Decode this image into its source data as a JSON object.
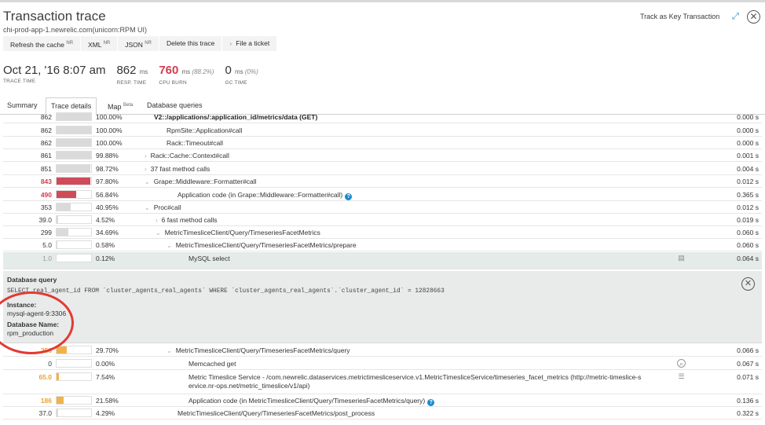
{
  "header": {
    "title": "Transaction trace",
    "subtitle": "chi-prod-app-1.newrelic.com(unicorn:RPM UI)",
    "key_link": "Track as Key Transaction"
  },
  "toolbar": [
    {
      "label": "Refresh the cache",
      "sup": "NR"
    },
    {
      "label": "XML",
      "sup": "NR"
    },
    {
      "label": "JSON",
      "sup": "NR"
    },
    {
      "label": "Delete this trace",
      "sup": ""
    },
    {
      "label": "File a ticket",
      "sup": ""
    }
  ],
  "stats": {
    "date": {
      "value": "Oct 21, '16 8:07 am",
      "label": "TRACE TIME"
    },
    "resp": {
      "value": "862",
      "unit": "ms",
      "label": "RESP. TIME"
    },
    "cpu": {
      "value": "760",
      "unit": "ms",
      "extra": "(88.2%)",
      "label": "CPU BURN"
    },
    "gc": {
      "value": "0",
      "unit": "ms",
      "extra": "(0%)",
      "label": "GC TIME"
    }
  },
  "tabs": [
    {
      "label": "Summary",
      "sup": ""
    },
    {
      "label": "Trace details",
      "sup": ""
    },
    {
      "label": "Map",
      "sup": "Beta"
    },
    {
      "label": "Database queries",
      "sup": ""
    }
  ],
  "rows": [
    {
      "num": "862",
      "pct": "100.00%",
      "fill": 1.0,
      "indent": 0,
      "chev": "",
      "name": "V2::/applications/:application_id/metrics/data (GET)",
      "time": "0.000 s",
      "bold": true
    },
    {
      "num": "862",
      "pct": "100.00%",
      "fill": 1.0,
      "indent": 1,
      "chev": "",
      "name": "RpmSite::Application#call",
      "time": "0.000 s"
    },
    {
      "num": "862",
      "pct": "100.00%",
      "fill": 1.0,
      "indent": 1,
      "chev": "",
      "name": "Rack::Timeout#call",
      "time": "0.000 s"
    },
    {
      "num": "861",
      "pct": "99.88%",
      "fill": 0.9988,
      "indent": 0,
      "chev": "›",
      "name": "Rack::Cache::Context#call",
      "time": "0.001 s"
    },
    {
      "num": "851",
      "pct": "98.72%",
      "fill": 0.9872,
      "indent": 0,
      "chev": "›",
      "name": "37 fast method calls",
      "time": "0.004 s"
    },
    {
      "num": "843",
      "pct": "97.80%",
      "fill": 0.978,
      "indent": 0,
      "chev": "⌄",
      "name": "Grape::Middleware::Formatter#call",
      "time": "0.012 s",
      "numColor": "red",
      "barColor": "#cf4b5a"
    },
    {
      "num": "490",
      "pct": "56.84%",
      "fill": 0.5684,
      "indent": 2,
      "chev": "",
      "name": "Application code (in Grape::Middleware::Formatter#call)",
      "time": "0.365 s",
      "numColor": "red",
      "barColor": "#cf4b5a",
      "help": true
    },
    {
      "num": "353",
      "pct": "40.95%",
      "fill": 0.4095,
      "indent": 0,
      "chev": "⌄",
      "name": "Proc#call",
      "time": "0.012 s"
    },
    {
      "num": "39.0",
      "pct": "4.52%",
      "fill": 0.0452,
      "indent": 1,
      "chev": "›",
      "name": "6 fast method calls",
      "time": "0.019 s"
    },
    {
      "num": "299",
      "pct": "34.69%",
      "fill": 0.3469,
      "indent": 1,
      "chev": "⌄",
      "name": "MetricTimesliceClient/Query/TimeseriesFacetMetrics",
      "time": "0.060 s"
    },
    {
      "num": "5.0",
      "pct": "0.58%",
      "fill": 0.0058,
      "indent": 2,
      "chev": "⌄",
      "name": "MetricTimesliceClient/Query/TimeseriesFacetMetrics/prepare",
      "time": "0.060 s"
    },
    {
      "num": "1.0",
      "pct": "0.12%",
      "fill": 0.0012,
      "indent": 3,
      "chev": "",
      "name": "MySQL select",
      "time": "0.064 s",
      "numColor": "grey",
      "highlight": true,
      "icon": "database-icon"
    }
  ],
  "db": {
    "heading": "Database query",
    "sql": "SELECT real_agent_id FROM `cluster_agents_real_agents` WHERE `cluster_agents_real_agents`.`cluster_agent_id` = 12828663",
    "instance_label": "Instance:",
    "instance": "mysql-agent-9:3306",
    "dbname_label": "Database Name:",
    "dbname": "rpm_production"
  },
  "rows_after": [
    {
      "num": "256",
      "pct": "29.70%",
      "fill": 0.297,
      "indent": 2,
      "chev": "⌄",
      "name": "MetricTimesliceClient/Query/TimeseriesFacetMetrics/query",
      "time": "0.066 s",
      "numColor": "org",
      "barColor": "#f0b34a"
    },
    {
      "num": "0",
      "pct": "0.00%",
      "fill": 0.0,
      "indent": 3,
      "chev": "",
      "name": "Memcached get",
      "time": "0.067 s",
      "icon": "search-icon"
    },
    {
      "num": "65.0",
      "pct": "7.54%",
      "fill": 0.0754,
      "indent": 3,
      "chev": "",
      "name": "Metric Timeslice Service - /com.newrelic.dataservices.metrictimesliceservice.v1.MetricTimesliceService/timeseries_facet_metrics (http://metric-timeslice-s",
      "name2": "ervice.nr-ops.net/metric_timeslice/v1/api)",
      "time": "0.071 s",
      "numColor": "org",
      "barColor": "#f0b34a",
      "icon": "list-icon",
      "tall": true
    },
    {
      "num": "186",
      "pct": "21.58%",
      "fill": 0.2158,
      "indent": 3,
      "chev": "",
      "name": "Application code (in MetricTimesliceClient/Query/TimeseriesFacetMetrics/query)",
      "time": "0.136 s",
      "numColor": "org",
      "barColor": "#f0b34a",
      "help": true
    },
    {
      "num": "37.0",
      "pct": "4.29%",
      "fill": 0.0429,
      "indent": 2,
      "chev": "",
      "name": "MetricTimesliceClient/Query/TimeseriesFacetMetrics/post_process",
      "time": "0.322 s"
    }
  ]
}
